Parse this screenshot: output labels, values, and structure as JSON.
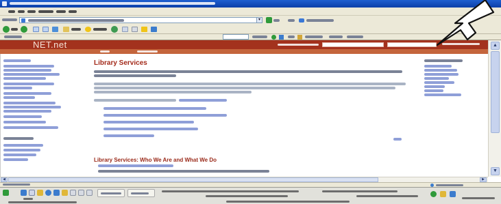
{
  "page": {
    "title": "Library Services",
    "section_heading": "Library Services: Who We Are and What We Do"
  },
  "site": {
    "logo": "NET.net"
  },
  "colors": {
    "titlebar": "#0b3fa8",
    "site_header": "#a3321d",
    "site_nav": "#c4653c",
    "heading": "#a32a1a",
    "link": "#8f9fd8"
  },
  "icons": {
    "back": "back-arrow-icon",
    "forward": "forward-arrow-icon",
    "stop": "stop-icon",
    "refresh": "refresh-icon",
    "home": "home-icon",
    "search": "search-icon",
    "favorites": "favorites-star-icon",
    "history": "history-icon",
    "mail": "mail-icon",
    "print": "printer-icon",
    "go": "go-arrow-icon",
    "cursor": "mouse-pointer-icon"
  }
}
